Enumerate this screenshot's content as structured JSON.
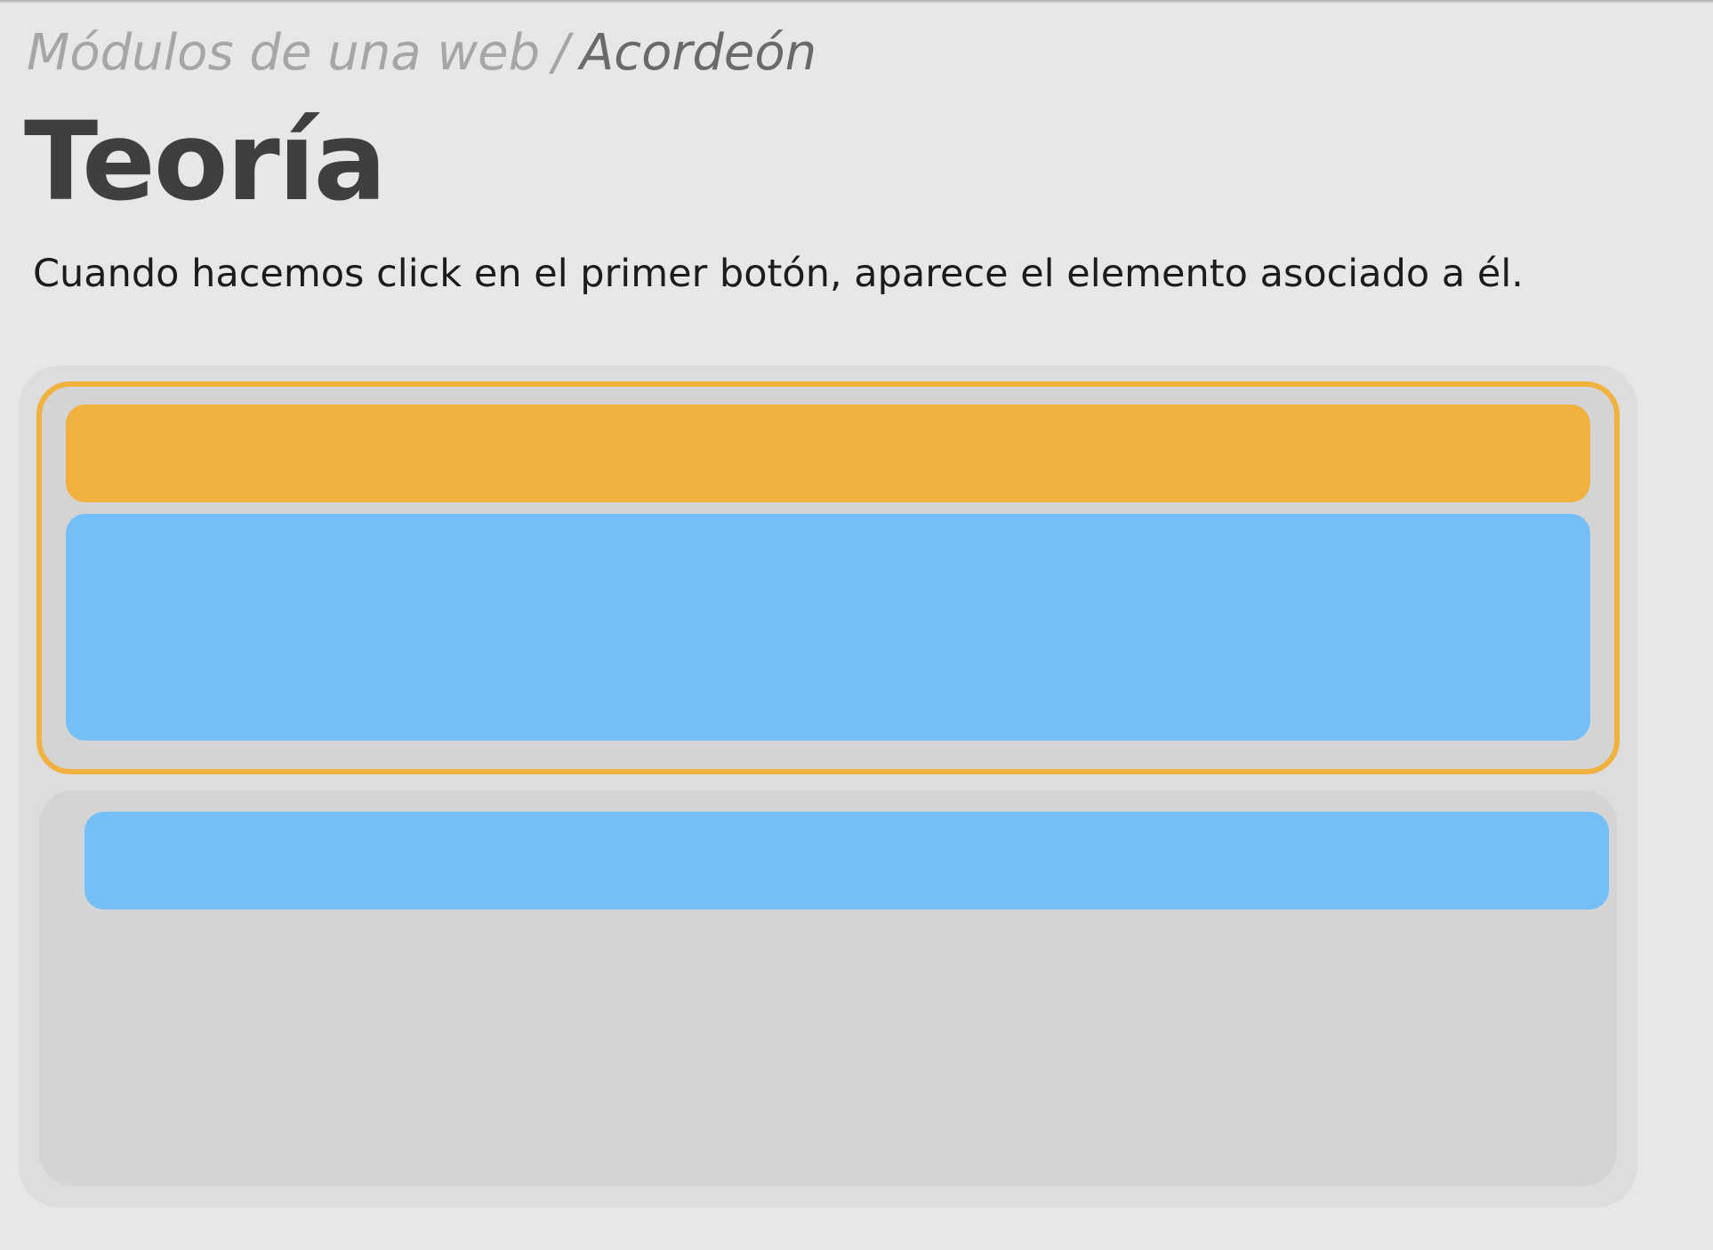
{
  "breadcrumb": {
    "parent": "Módulos de una web",
    "separator": "/",
    "current": "Acordeón"
  },
  "page": {
    "title": "Teoría",
    "description": "Cuando hacemos click en el primer botón, aparece el elemento asociado a él."
  },
  "diagram": {
    "items": [
      {
        "state": "expanded",
        "active": true
      },
      {
        "state": "collapsed",
        "active": false
      }
    ]
  },
  "colors": {
    "accent_orange": "#f1b13f",
    "accent_blue": "#74bff8",
    "panel_bg": "#dddddd",
    "item_bg": "#d4d4d4",
    "page_bg": "#e7e7e7"
  }
}
